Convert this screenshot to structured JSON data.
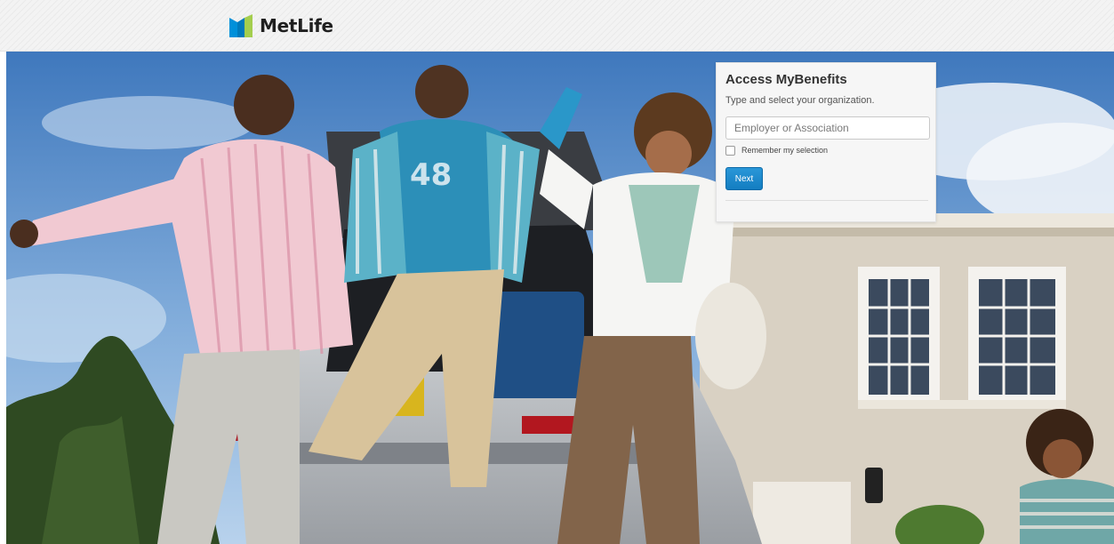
{
  "header": {
    "brand": "MetLife"
  },
  "login_card": {
    "title": "Access MyBenefits",
    "subtitle": "Type and select your organization.",
    "organization_input": {
      "placeholder": "Employer or Association",
      "value": ""
    },
    "remember_label": "Remember my selection",
    "remember_checked": false,
    "next_label": "Next"
  },
  "hero": {
    "jersey_number": "48"
  },
  "colors": {
    "logo_blue": "#0090da",
    "logo_green": "#a4ce4e",
    "button_blue": "#1a87cb",
    "card_background": "#f6f6f6",
    "header_background": "#f3f3f3"
  },
  "icons": {
    "logo": "metlife-logo-icon",
    "checkbox": "checkbox-icon"
  }
}
